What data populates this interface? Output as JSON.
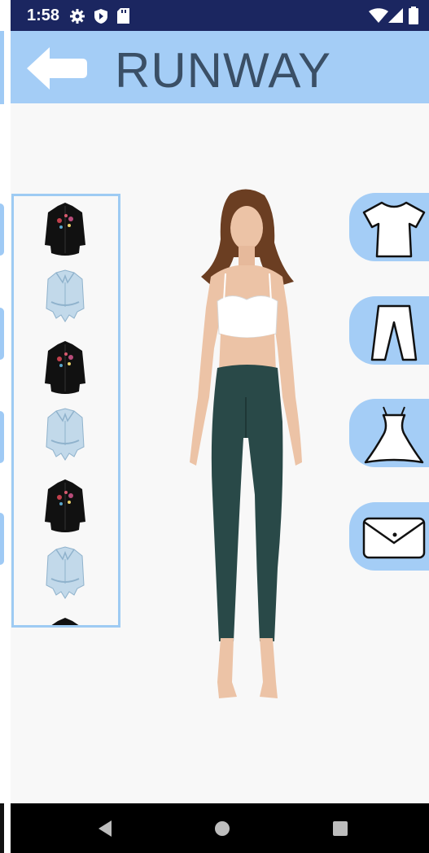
{
  "status_bar": {
    "time": "1:58",
    "icons": [
      "settings-icon",
      "play-protect-icon",
      "sd-card-icon",
      "wifi-icon",
      "cell-signal-icon",
      "battery-icon"
    ]
  },
  "app_bar": {
    "title": "RUNWAY",
    "back_icon": "arrow-left-icon",
    "color": "#a4cdf6"
  },
  "clothing_list": {
    "items": [
      {
        "name": "black-embroidered-shirt"
      },
      {
        "name": "denim-tie-front-shirt"
      },
      {
        "name": "black-embroidered-shirt"
      },
      {
        "name": "denim-tie-front-shirt"
      },
      {
        "name": "black-embroidered-shirt"
      },
      {
        "name": "denim-tie-front-shirt"
      }
    ]
  },
  "categories": [
    {
      "name": "tops",
      "icon": "tshirt-icon"
    },
    {
      "name": "pants",
      "icon": "pants-icon"
    },
    {
      "name": "dresses",
      "icon": "dress-icon"
    },
    {
      "name": "bags",
      "icon": "clutch-bag-icon"
    }
  ],
  "nav_bar": [
    "back-triangle-icon",
    "home-circle-icon",
    "recents-square-icon"
  ]
}
